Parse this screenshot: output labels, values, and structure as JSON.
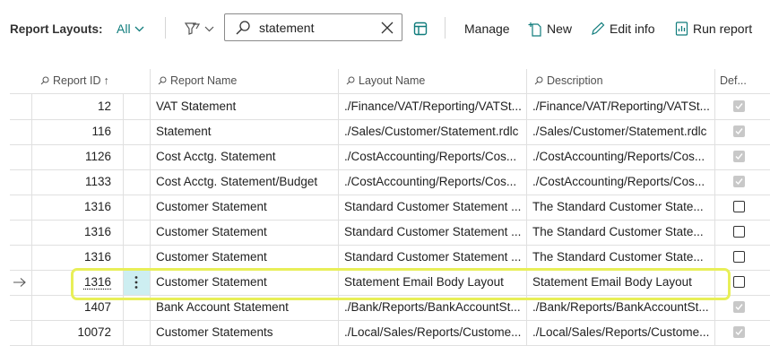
{
  "toolbar": {
    "title": "Report Layouts:",
    "filter_label": "All",
    "search_value": "statement",
    "manage_label": "Manage",
    "new_label": "New",
    "edit_info_label": "Edit info",
    "run_report_label": "Run report"
  },
  "columns": {
    "report_id": "Report ID",
    "report_id_sort": "↑",
    "report_name": "Report Name",
    "layout_name": "Layout Name",
    "description": "Description",
    "default": "Def..."
  },
  "rows": [
    {
      "id": "12",
      "name": "VAT Statement",
      "layout": "./Finance/VAT/Reporting/VATSt...",
      "desc": "./Finance/VAT/Reporting/VATSt...",
      "default": true
    },
    {
      "id": "116",
      "name": "Statement",
      "layout": "./Sales/Customer/Statement.rdlc",
      "desc": "./Sales/Customer/Statement.rdlc",
      "default": true
    },
    {
      "id": "1126",
      "name": "Cost Acctg. Statement",
      "layout": "./CostAccounting/Reports/Cos...",
      "desc": "./CostAccounting/Reports/Cos...",
      "default": true
    },
    {
      "id": "1133",
      "name": "Cost Acctg. Statement/Budget",
      "layout": "./CostAccounting/Reports/Cos...",
      "desc": "./CostAccounting/Reports/Cos...",
      "default": true
    },
    {
      "id": "1316",
      "name": "Customer Statement",
      "layout": "Standard Customer Statement ...",
      "desc": "The Standard Customer State...",
      "default": false
    },
    {
      "id": "1316",
      "name": "Customer Statement",
      "layout": "Standard Customer Statement ...",
      "desc": "The Standard Customer State...",
      "default": false
    },
    {
      "id": "1316",
      "name": "Customer Statement",
      "layout": "Standard Customer Statement ...",
      "desc": "The Standard Customer State...",
      "default": false
    },
    {
      "id": "1316",
      "name": "Customer Statement",
      "layout": "Statement Email Body Layout",
      "desc": "Statement Email Body Layout",
      "default": false,
      "selected": true
    },
    {
      "id": "1407",
      "name": "Bank Account Statement",
      "layout": "./Bank/Reports/BankAccountSt...",
      "desc": "./Bank/Reports/BankAccountSt...",
      "default": true
    },
    {
      "id": "10072",
      "name": "Customer Statements",
      "layout": "./Local/Sales/Reports/Custome...",
      "desc": "./Local/Sales/Reports/Custome...",
      "default": true
    }
  ],
  "colors": {
    "accent": "#107c7c",
    "highlight": "#e8ef58",
    "selected_cell": "#cdeef1"
  }
}
